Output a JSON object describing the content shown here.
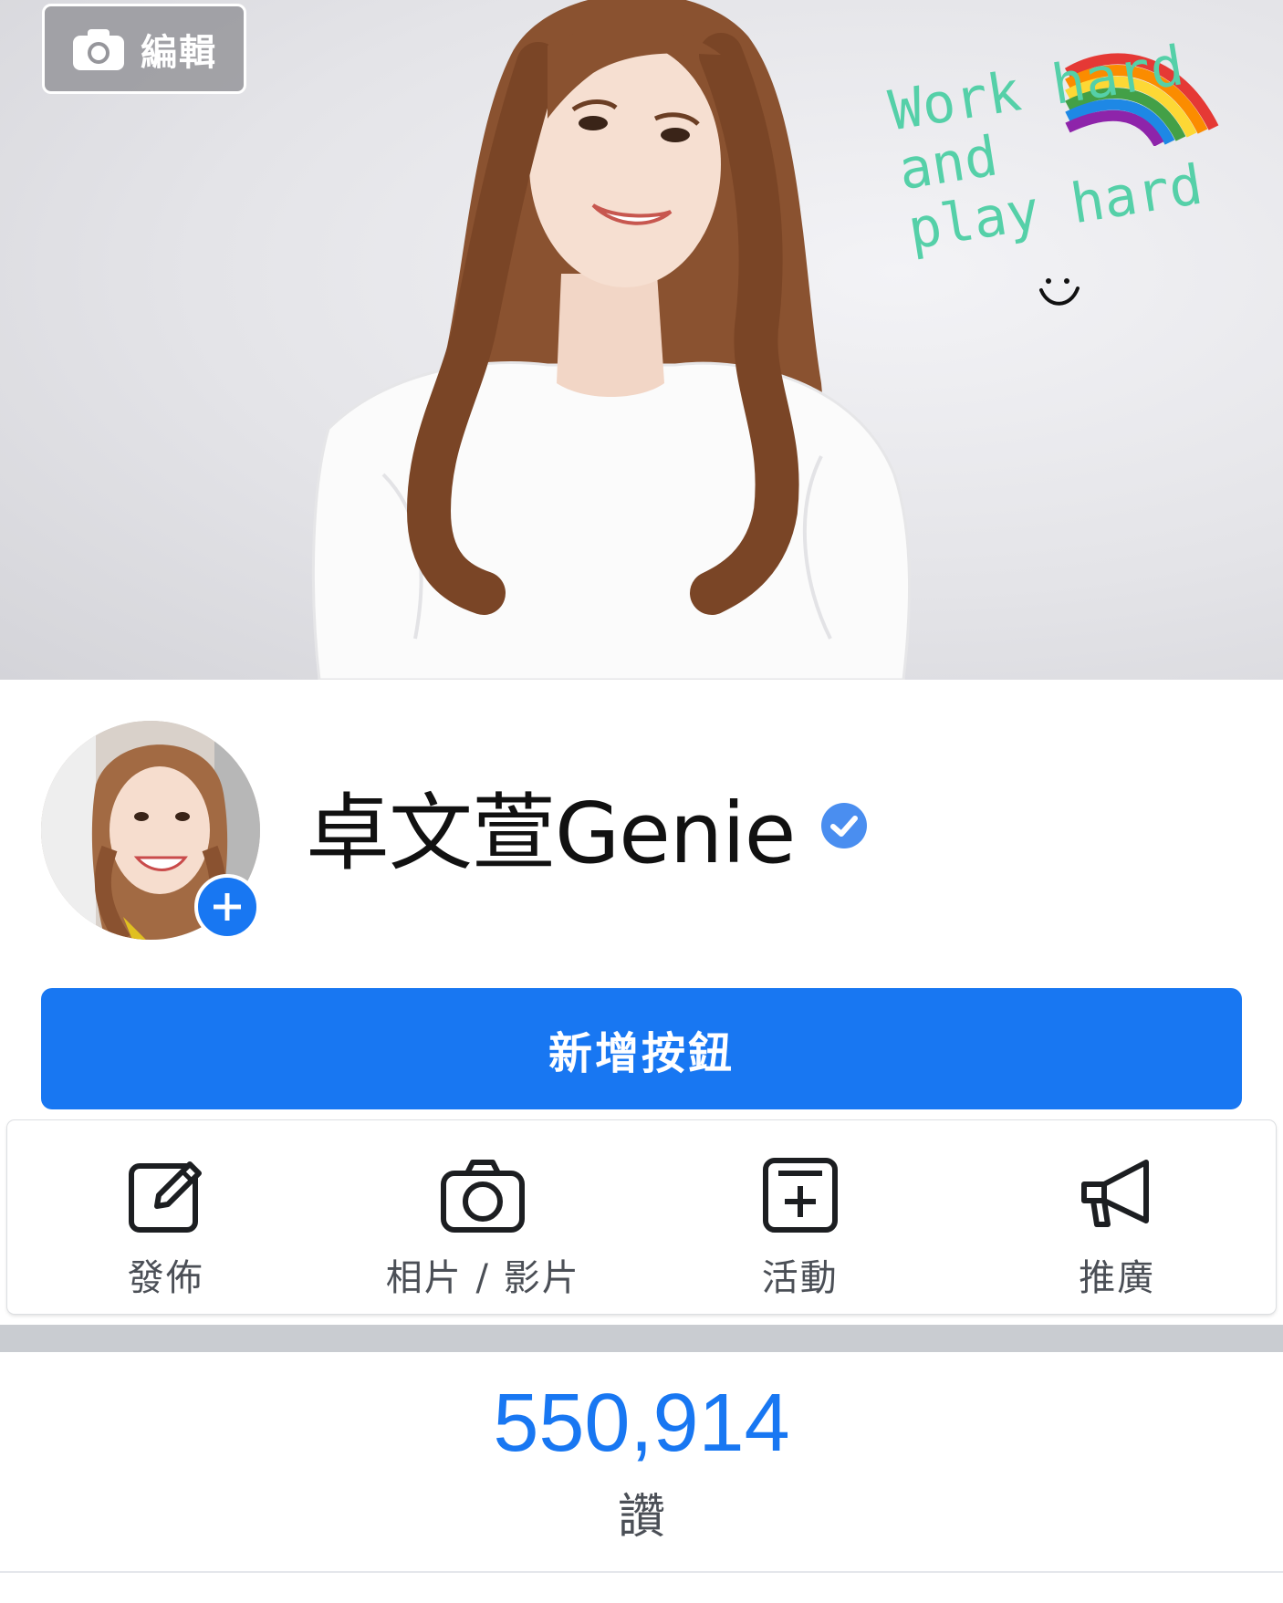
{
  "cover": {
    "edit_label": "編輯",
    "handwriting": [
      "Work hard",
      "and",
      "play hard"
    ]
  },
  "profile": {
    "name": "卓文萱Genie",
    "verified": true,
    "accent_color": "#1877f2"
  },
  "add_button_label": "新增按鈕",
  "actions": [
    {
      "label": "發佈",
      "icon": "compose-icon"
    },
    {
      "label": "相片 / 影片",
      "icon": "camera-icon"
    },
    {
      "label": "活動",
      "icon": "event-add-icon"
    },
    {
      "label": "推廣",
      "icon": "megaphone-icon"
    }
  ],
  "likes": {
    "count": "550,914",
    "label": "讚"
  }
}
